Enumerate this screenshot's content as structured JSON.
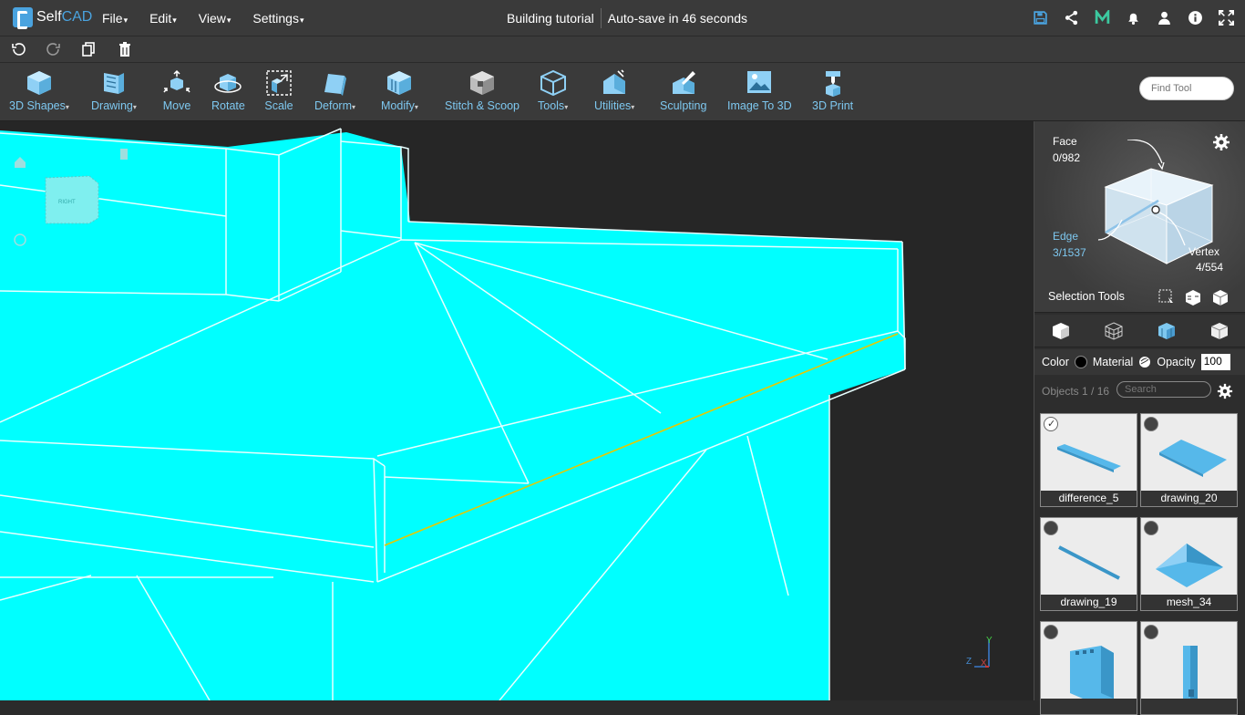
{
  "app": {
    "name_a": "Self",
    "name_b": "CAD"
  },
  "menu": [
    "File",
    "Edit",
    "View",
    "Settings"
  ],
  "project": {
    "title": "Building tutorial",
    "autosave": "Auto-save in 46 seconds"
  },
  "top_icons": [
    "save-icon",
    "share-icon",
    "m-icon",
    "bell-icon",
    "user-icon",
    "info-icon",
    "fullscreen-icon"
  ],
  "sub_icons": [
    "undo-icon",
    "redo-icon",
    "copy-icon",
    "trash-icon"
  ],
  "tools": [
    {
      "label": "3D Shapes",
      "dropdown": true
    },
    {
      "label": "Drawing",
      "dropdown": true
    },
    {
      "label": "Move",
      "dropdown": false
    },
    {
      "label": "Rotate",
      "dropdown": false
    },
    {
      "label": "Scale",
      "dropdown": false
    },
    {
      "label": "Deform",
      "dropdown": true
    },
    {
      "label": "Modify",
      "dropdown": true
    },
    {
      "label": "Stitch & Scoop",
      "dropdown": false
    },
    {
      "label": "Tools",
      "dropdown": true
    },
    {
      "label": "Utilities",
      "dropdown": true
    },
    {
      "label": "Sculpting",
      "dropdown": false
    },
    {
      "label": "Image To 3D",
      "dropdown": false
    },
    {
      "label": "3D Print",
      "dropdown": false
    }
  ],
  "find_tool": {
    "placeholder": "Find Tool"
  },
  "view_cube": {
    "label": "RIGHT"
  },
  "selection": {
    "face_label": "Face",
    "face_count": "0/982",
    "edge_label": "Edge",
    "edge_count": "3/1537",
    "vertex_label": "Vertex",
    "vertex_count": "4/554",
    "tools_label": "Selection Tools"
  },
  "properties": {
    "color_label": "Color",
    "material_label": "Material",
    "opacity_label": "Opacity",
    "opacity_value": "100"
  },
  "objects": {
    "count_label": "Objects 1 / 16",
    "search_placeholder": "Search"
  },
  "object_cards": [
    {
      "name": "difference_5",
      "checked": true
    },
    {
      "name": "drawing_20",
      "checked": false
    },
    {
      "name": "drawing_19",
      "checked": false
    },
    {
      "name": "mesh_34",
      "checked": false
    },
    {
      "name": "",
      "checked": false
    },
    {
      "name": "",
      "checked": false
    }
  ],
  "axes": {
    "x": "X",
    "y": "Y",
    "z": "Z"
  },
  "colors": {
    "accent": "#4aa3df",
    "model": "#00ffff",
    "selected_edge": "#ffd400"
  }
}
